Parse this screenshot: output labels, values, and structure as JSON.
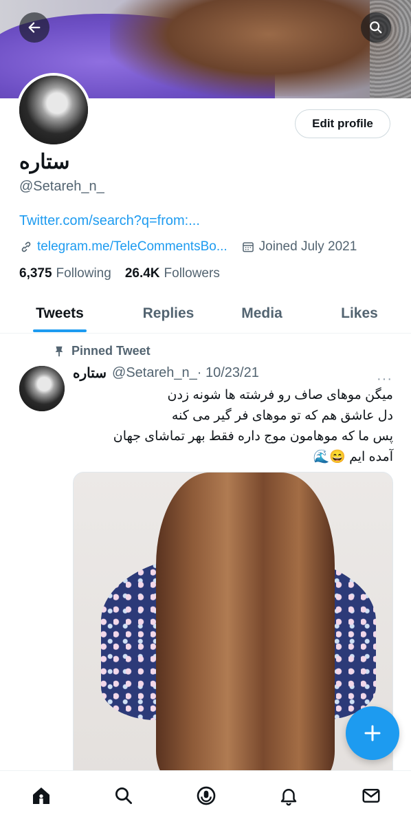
{
  "header": {
    "back_icon": "arrow-left-icon",
    "search_icon": "search-icon"
  },
  "profile": {
    "name": "ستاره",
    "handle": "@Setareh_n_",
    "edit_button": "Edit profile",
    "bio_link": "Twitter.com/search?q=from:...",
    "website": "telegram.me/TeleCommentsBo...",
    "joined": "Joined July 2021",
    "following_count": "6,375",
    "following_label": "Following",
    "followers_count": "26.4K",
    "followers_label": "Followers"
  },
  "tabs": [
    {
      "label": "Tweets",
      "active": true
    },
    {
      "label": "Replies",
      "active": false
    },
    {
      "label": "Media",
      "active": false
    },
    {
      "label": "Likes",
      "active": false
    }
  ],
  "tweet": {
    "pinned_label": "Pinned Tweet",
    "author_name": "ستاره",
    "author_handle": "@Setareh_n_",
    "date": " · 10/23/21",
    "more": "···",
    "lines": [
      "میگن موهای صاف رو فرشته ها شونه زدن",
      "دل عاشق هم که تو موهای فر گیر می کنه",
      "پس ما که موهامون موج داره فقط بهر تماشای جهان",
      "آمده ایم 😄🌊"
    ]
  },
  "fab": {
    "label": "+",
    "icon": "compose-icon"
  },
  "bottom_nav": [
    {
      "icon": "home-icon"
    },
    {
      "icon": "search-icon"
    },
    {
      "icon": "spaces-icon"
    },
    {
      "icon": "bell-icon"
    },
    {
      "icon": "mail-icon"
    }
  ],
  "colors": {
    "accent": "#1d9bf0",
    "text": "#0f1419",
    "muted": "#536471"
  }
}
